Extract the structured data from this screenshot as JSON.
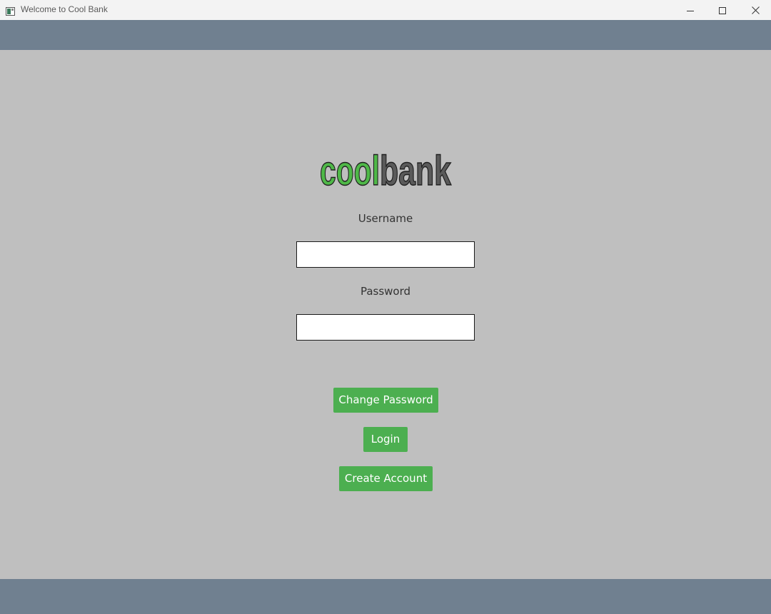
{
  "window": {
    "title": "Welcome to Cool Bank",
    "controls": {
      "minimize_icon": "minimize-icon",
      "maximize_icon": "maximize-icon",
      "close_icon": "close-icon"
    }
  },
  "colors": {
    "background": "#bfbfbf",
    "bar": "#708090",
    "accent_green": "#4caf50",
    "logo_green": "#4fb848",
    "logo_gray": "#5a5a5a"
  },
  "logo": {
    "part1": "cool",
    "part2": "bank"
  },
  "form": {
    "username_label": "Username",
    "username_value": "",
    "password_label": "Password",
    "password_value": ""
  },
  "buttons": {
    "change_password": "Change Password",
    "login": "Login",
    "create_account": "Create Account"
  }
}
